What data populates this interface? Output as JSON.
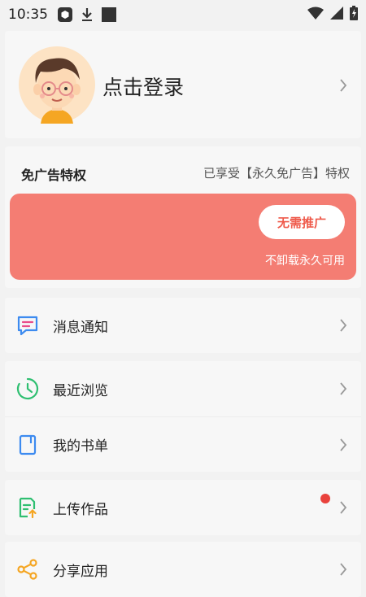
{
  "status_bar": {
    "time": "10:35",
    "left_icons": [
      "app-icon",
      "download-icon",
      "stop-icon"
    ],
    "right_icons": [
      "wifi-icon",
      "signal-icon",
      "battery-charging-icon"
    ]
  },
  "profile": {
    "login_label": "点击登录",
    "avatar": "avatar-illustration"
  },
  "ad_free": {
    "title": "免广告特权",
    "status": "已享受【永久免广告】特权",
    "button_label": "无需推广",
    "banner_note": "不卸载永久可用",
    "banner_color": "#f47d73",
    "button_text_color": "#ef5a4b"
  },
  "menu": {
    "messages": {
      "label": "消息通知",
      "icon": "message-icon"
    },
    "history": {
      "label": "最近浏览",
      "icon": "clock-icon"
    },
    "booklist": {
      "label": "我的书单",
      "icon": "book-icon"
    },
    "upload": {
      "label": "上传作品",
      "icon": "upload-file-icon",
      "has_badge": true
    },
    "share": {
      "label": "分享应用",
      "icon": "share-icon"
    }
  }
}
